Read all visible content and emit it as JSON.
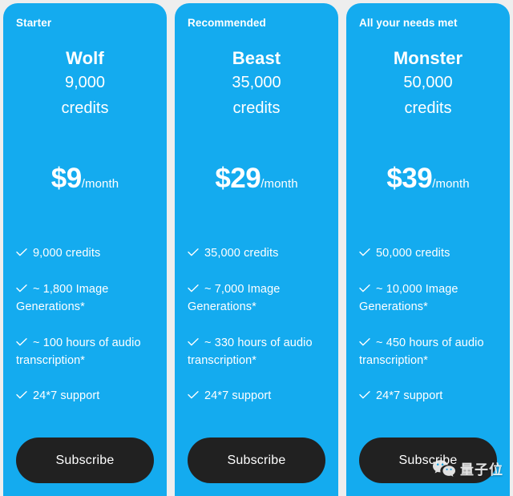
{
  "theme": {
    "card_blue": "#14ABEF",
    "page_background": "#eeeeee",
    "button_dark": "#212121",
    "text_white": "#ffffff"
  },
  "plans": [
    {
      "badge": "Starter",
      "name": "Wolf",
      "credits_amount": "9,000",
      "credits_label": "credits",
      "price": "$9",
      "period": "/month",
      "features": [
        "9,000 credits",
        "~ 1,800 Image Generations*",
        "~ 100 hours of audio transcription*",
        "24*7 support"
      ],
      "cta": "Subscribe"
    },
    {
      "badge": "Recommended",
      "name": "Beast",
      "credits_amount": "35,000",
      "credits_label": "credits",
      "price": "$29",
      "period": "/month",
      "features": [
        "35,000 credits",
        "~ 7,000 Image Generations*",
        "~ 330 hours of audio transcription*",
        "24*7 support"
      ],
      "cta": "Subscribe"
    },
    {
      "badge": "All your needs met",
      "name": "Monster",
      "credits_amount": "50,000",
      "credits_label": "credits",
      "price": "$39",
      "period": "/month",
      "features": [
        "50,000 credits",
        "~ 10,000 Image Generations*",
        "~ 450 hours of audio transcription*",
        "24*7 support"
      ],
      "cta": "Subscribe"
    }
  ],
  "watermark": {
    "icon": "wechat-icon",
    "text": "量子位"
  }
}
